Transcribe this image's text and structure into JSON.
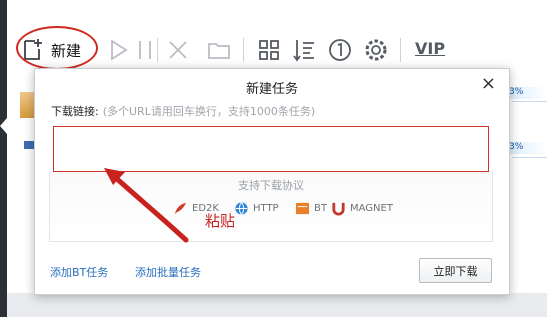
{
  "toolbar": {
    "new_label": "新建",
    "vip_label": "VIP",
    "icons": [
      "new-task-icon",
      "play-icon",
      "pause-icon",
      "delete-icon",
      "folder-icon",
      "grid-view-icon",
      "sort-icon",
      "speed-limit-icon",
      "settings-icon"
    ]
  },
  "background_list": {
    "pct_1": "3%",
    "pct_2": "3%"
  },
  "dialog": {
    "title": "新建任务",
    "close_symbol": "×",
    "label": "下载链接:",
    "hint": "(多个URL请用回车换行，支持1000条任务)",
    "input_value": "",
    "protocols_title": "支持下载协议",
    "protocols": [
      {
        "name": "ED2K",
        "icon": "ed2k-icon",
        "color": "#d03a2a"
      },
      {
        "name": "HTTP",
        "icon": "http-icon",
        "color": "#2e8ad8"
      },
      {
        "name": "BT",
        "icon": "bt-icon",
        "color": "#e8802a"
      },
      {
        "name": "MAGNET",
        "icon": "magnet-icon",
        "color": "#c0392b"
      }
    ],
    "link_add_bt": "添加BT任务",
    "link_add_batch": "添加批量任务",
    "download_button": "立即下载"
  },
  "annotation": {
    "text": "粘贴",
    "color": "#c9211d"
  }
}
